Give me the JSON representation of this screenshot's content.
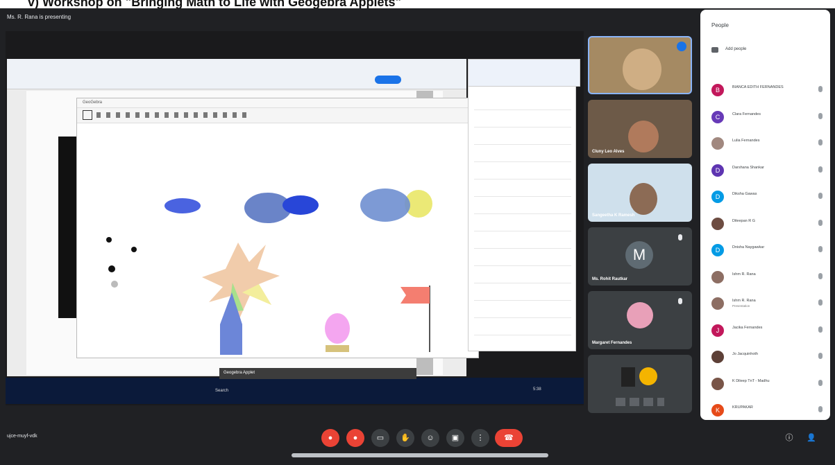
{
  "slide_caption": "v)        Workshop on \"Bringing Math to Life with Geogebra Applets\"",
  "meet": {
    "presenting_label": "Ms. R. Rana is presenting",
    "meeting_code": "ujce-muyf-vdk"
  },
  "tiles": [
    {
      "name": ""
    },
    {
      "name": "Cluny Leo Alves"
    },
    {
      "name": "Sangeetha K Ramesh"
    },
    {
      "name": "Ms. Rohit Rautkar",
      "avatar_letter": "M"
    },
    {
      "name": "Margaret Fernandes"
    }
  ],
  "people_panel": {
    "title": "People",
    "add_people_label": "Add people",
    "participants": [
      {
        "name": "BIANCA EDITH FERNANDES",
        "sub": "",
        "color": "#c2185b",
        "initial": "B"
      },
      {
        "name": "Clara Fernandes",
        "sub": "",
        "color": "#673ab7",
        "initial": "C"
      },
      {
        "name": "Lulia Fernandes",
        "sub": "",
        "color": "#a1887f",
        "initial": ""
      },
      {
        "name": "Darshana Shankar",
        "sub": "",
        "color": "#5e35b1",
        "initial": "D"
      },
      {
        "name": "Diksha Gawas",
        "sub": "",
        "color": "#039be5",
        "initial": "D"
      },
      {
        "name": "Dileepan R G",
        "sub": "",
        "color": "#6d4c41",
        "initial": ""
      },
      {
        "name": "Dnisha Naygawkar",
        "sub": "",
        "color": "#039be5",
        "initial": "D"
      },
      {
        "name": "Ishm R. Rana",
        "sub": "",
        "color": "#8d6e63",
        "initial": ""
      },
      {
        "name": "Ishm R. Rana",
        "sub": "Presentation",
        "color": "#8d6e63",
        "initial": ""
      },
      {
        "name": "Jacika Fernandes",
        "sub": "",
        "color": "#c2185b",
        "initial": "J"
      },
      {
        "name": "Jo Jacquinhoth",
        "sub": "",
        "color": "#5d4037",
        "initial": ""
      },
      {
        "name": "K Dileep TnT - Madhu",
        "sub": "",
        "color": "#795548",
        "initial": ""
      },
      {
        "name": "KRUPAKAR",
        "sub": "",
        "color": "#e64a19",
        "initial": "K"
      }
    ]
  },
  "shared_screen": {
    "app_title": "GeoGebra",
    "taskbar_search": "Search",
    "taskbar_tooltip": "Geogebra Applet",
    "taskbar_time": "5:38"
  }
}
